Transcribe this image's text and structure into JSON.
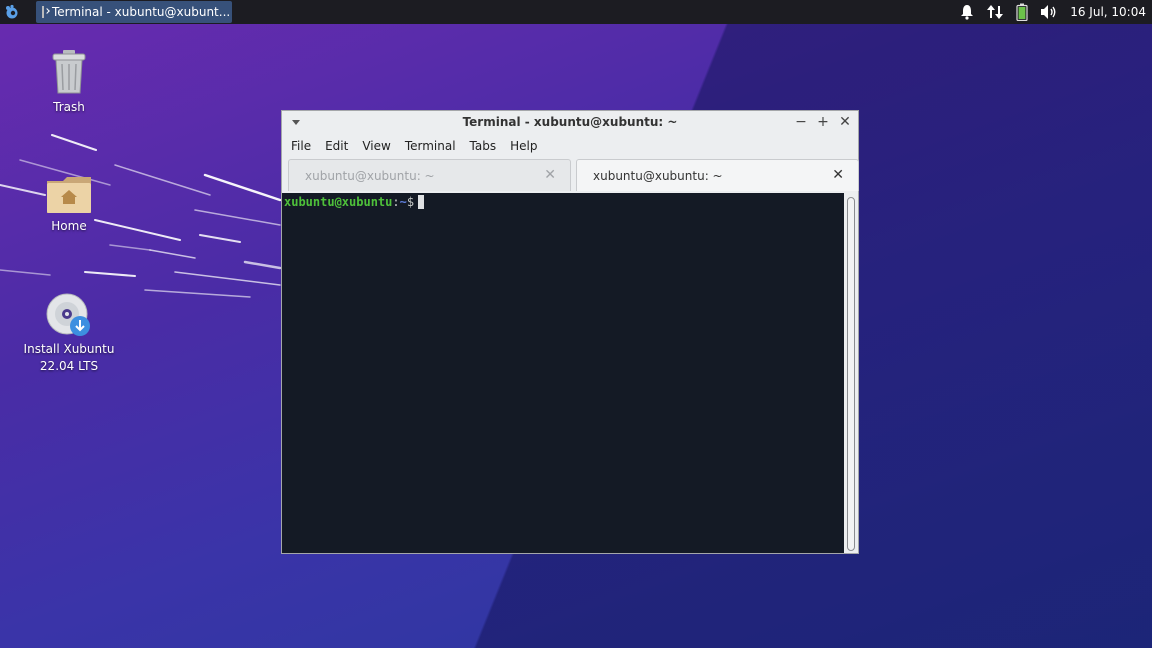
{
  "panel": {
    "task_button_label": "Terminal - xubuntu@xubunt...",
    "clock": "16 Jul, 10:04",
    "tray_icons": [
      "bell-icon",
      "network-icon",
      "battery-icon",
      "volume-icon"
    ]
  },
  "desktop": {
    "icons": [
      {
        "label": "Trash",
        "icon": "trash-icon"
      },
      {
        "label": "Home",
        "icon": "home-folder-icon"
      },
      {
        "label_line1": "Install Xubuntu",
        "label_line2": "22.04 LTS",
        "icon": "install-disc-icon"
      }
    ]
  },
  "window": {
    "title": "Terminal - xubuntu@xubuntu: ~",
    "menu": [
      "File",
      "Edit",
      "View",
      "Terminal",
      "Tabs",
      "Help"
    ],
    "tabs": [
      {
        "label": "xubuntu@xubuntu: ~",
        "active": false
      },
      {
        "label": "xubuntu@xubuntu: ~",
        "active": true
      }
    ],
    "terminal": {
      "prompt_user": "xubuntu@xubuntu",
      "prompt_sep": ":",
      "prompt_path": "~",
      "prompt_symbol": "$"
    }
  },
  "colors": {
    "terminal_bg": "#141a25",
    "prompt_user": "#4ec03a",
    "prompt_path": "#5f7fdc",
    "panel_bg": "#1c1c22",
    "task_button_active": "#37517a"
  }
}
